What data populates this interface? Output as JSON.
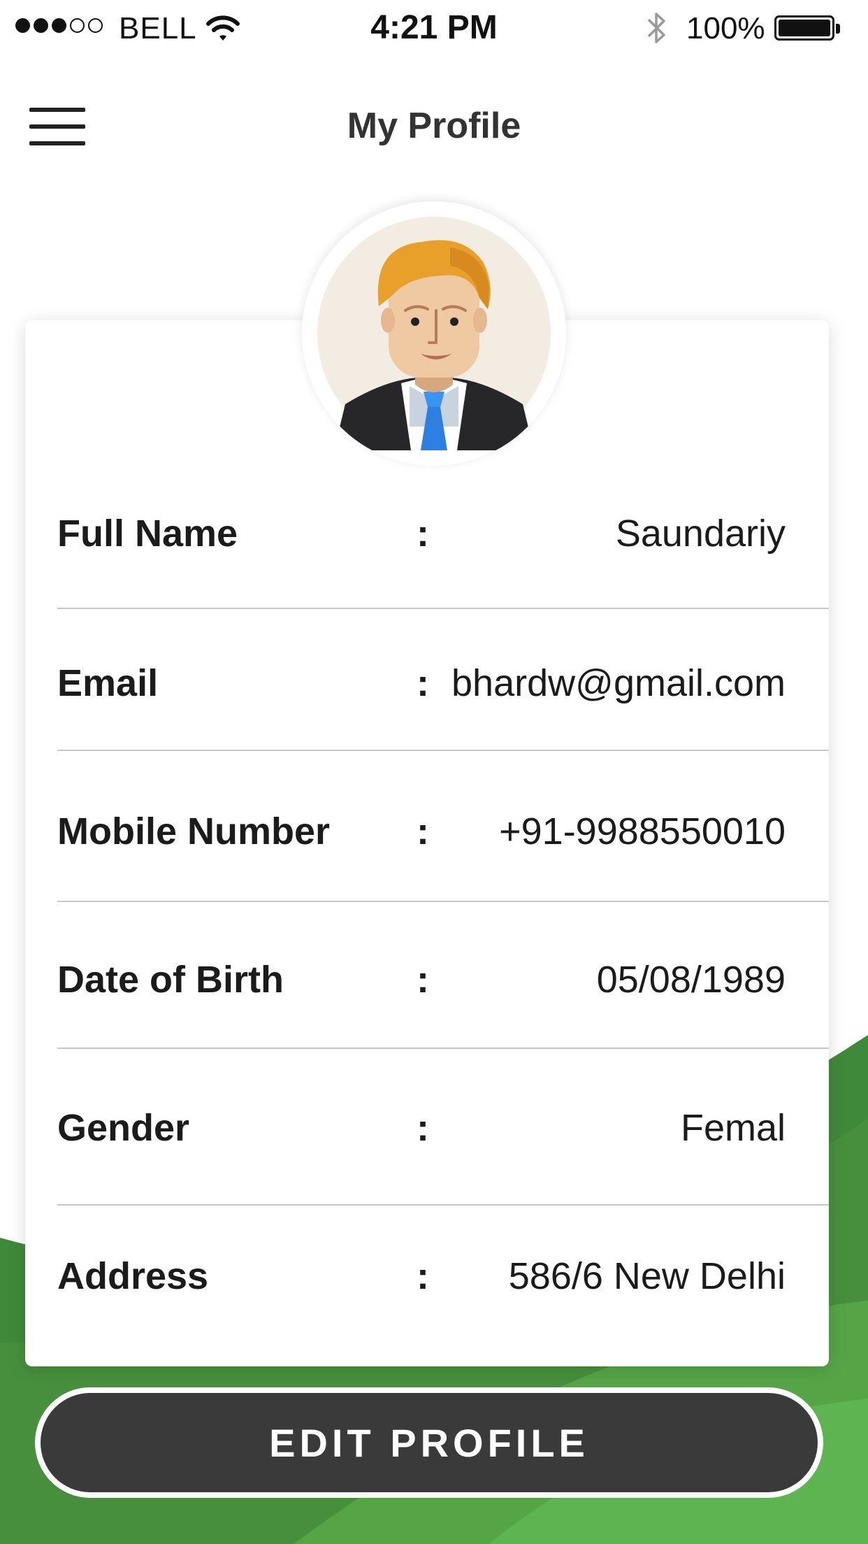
{
  "status_bar": {
    "carrier": "BELL",
    "time": "4:21 PM",
    "battery_percent": "100%",
    "signal_bars": 3,
    "signal_total": 5
  },
  "header": {
    "title": "My Profile",
    "menu_icon": "hamburger-menu-icon"
  },
  "profile": {
    "avatar_icon": "male-user-avatar",
    "fields": [
      {
        "label": "Full Name",
        "separator": ":",
        "value": "Saundariy"
      },
      {
        "label": "Email",
        "separator": ":",
        "value": "bhardw@gmail.com"
      },
      {
        "label": "Mobile Number",
        "separator": ":",
        "value": "+91-9988550010"
      },
      {
        "label": "Date of Birth",
        "separator": ":",
        "value": "05/08/1989"
      },
      {
        "label": "Gender",
        "separator": ":",
        "value": "Femal"
      },
      {
        "label": "Address",
        "separator": ":",
        "value": "586/6 New Delhi"
      }
    ]
  },
  "actions": {
    "edit_label": "EDIT PROFILE"
  },
  "colors": {
    "accent_green": "#4a9a3f",
    "button_dark": "#3a3a3a"
  }
}
